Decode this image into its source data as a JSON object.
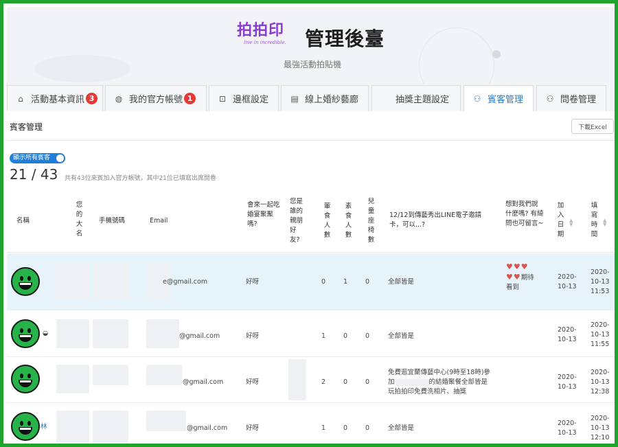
{
  "header": {
    "logo_text": "拍拍印",
    "logo_tagline": "live in incredible.",
    "title": "管理後臺",
    "subtitle": "最強活動拍貼機"
  },
  "tabs": [
    {
      "label": "活動基本資訊",
      "icon": "home-icon",
      "badge": "3",
      "active": false
    },
    {
      "label": "我的官方帳號",
      "icon": "globe-icon",
      "badge": "1",
      "active": false
    },
    {
      "label": "邊框設定",
      "icon": "frame-icon",
      "badge": "",
      "active": false
    },
    {
      "label": "線上婚紗藝廊",
      "icon": "file-icon",
      "badge": "",
      "active": false
    },
    {
      "label": "抽獎主題設定",
      "icon": "apple-icon",
      "badge": "",
      "active": false
    },
    {
      "label": "賓客管理",
      "icon": "users-icon",
      "badge": "",
      "active": true
    },
    {
      "label": "問卷管理",
      "icon": "users-icon",
      "badge": "",
      "active": false
    }
  ],
  "section": {
    "title": "賓客管理",
    "download_label": "下載Excel",
    "toggle_label": "顯示所有賓客",
    "count": "21 / 43",
    "count_note": "共有43位來賓加入官方帳號，其中21位已填寫出席問卷"
  },
  "columns": {
    "name": "名稱",
    "real_name": "您的大名",
    "phone": "手機號碼",
    "email": "Email",
    "attend": "會來一起吃婚宴聚聚嗎?",
    "relation": "您是誰的親朋好友?",
    "meat": "葷食人數",
    "veg": "素食人數",
    "child": "兒童座椅數",
    "q1": "12/12到傳藝秀出LINE電子邀請卡，可以...?",
    "msg": "想對我們說什麼嗎? 有綺問也可留言~",
    "joined": "加入日期",
    "filled": "填寫時間"
  },
  "rows": [
    {
      "email": "e@gmail.com",
      "attend": "好呀",
      "meat": "0",
      "veg": "1",
      "child": "0",
      "q1": "全部皆是",
      "msg_hearts": "♥♥♥",
      "msg_hearts2": "♥♥",
      "msg_text": "期待",
      "msg_text2": "看到",
      "joined_a": "2020-",
      "joined_b": "10-13",
      "filled_a": "2020-",
      "filled_b": "10-13",
      "filled_c": "11:53",
      "highlight": true
    },
    {
      "email": "@gmail.com",
      "attend": "好呀",
      "meat": "1",
      "veg": "0",
      "child": "0",
      "q1": "全部皆是",
      "joined_a": "2020-",
      "joined_b": "10-13",
      "filled_a": "2020-",
      "filled_b": "10-13",
      "filled_c": "11:55"
    },
    {
      "email": "@gmail.com",
      "attend": "好呀",
      "meat": "2",
      "veg": "0",
      "child": "0",
      "q1_line1": "免費逛宜蘭傳藝中心(9時至18時)參",
      "q1_line2": "的結婚聚餐全部皆是",
      "q1_line2_prefix": "加",
      "q1_line3": "玩拍拍印免費洗相片、抽獎",
      "joined_a": "2020-",
      "joined_b": "10-13",
      "filled_a": "2020-",
      "filled_b": "10-13",
      "filled_c": "12:38"
    },
    {
      "email": "@gmail.com",
      "attend": "好呀",
      "meat": "1",
      "veg": "0",
      "child": "0",
      "q1": "全部皆是",
      "name_tail": "林",
      "joined_a": "2020-",
      "joined_b": "10-13",
      "filled_a": "2020-",
      "filled_b": "10-13",
      "filled_c": "12:10"
    }
  ],
  "colors": {
    "frame": "#1fa52d",
    "accent": "#1f7ed8",
    "badge": "#e53935",
    "avatar": "#27b24a",
    "logo": "#8a3bd1"
  }
}
